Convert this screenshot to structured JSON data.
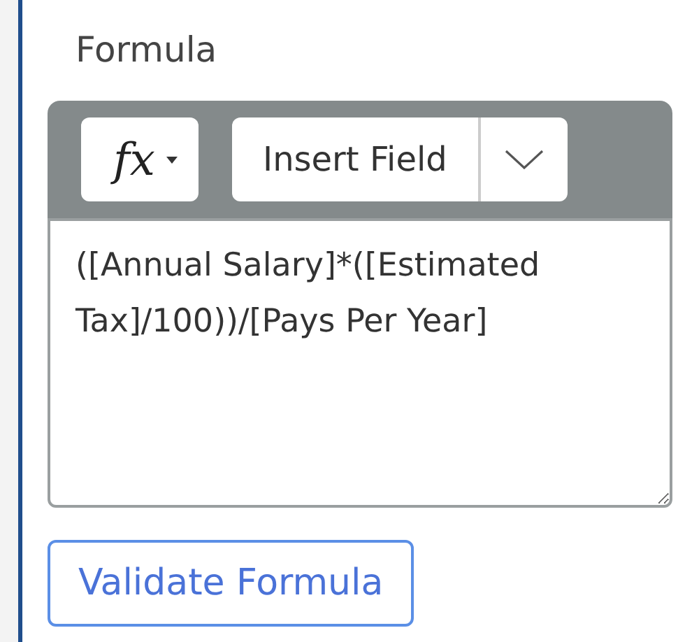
{
  "label": "Formula",
  "toolbar": {
    "function_button": "fx",
    "insert_field": "Insert Field"
  },
  "formula": "([Annual Salary]*([Estimated Tax]/100))/[Pays Per Year]",
  "validate_button": "Validate Formula"
}
